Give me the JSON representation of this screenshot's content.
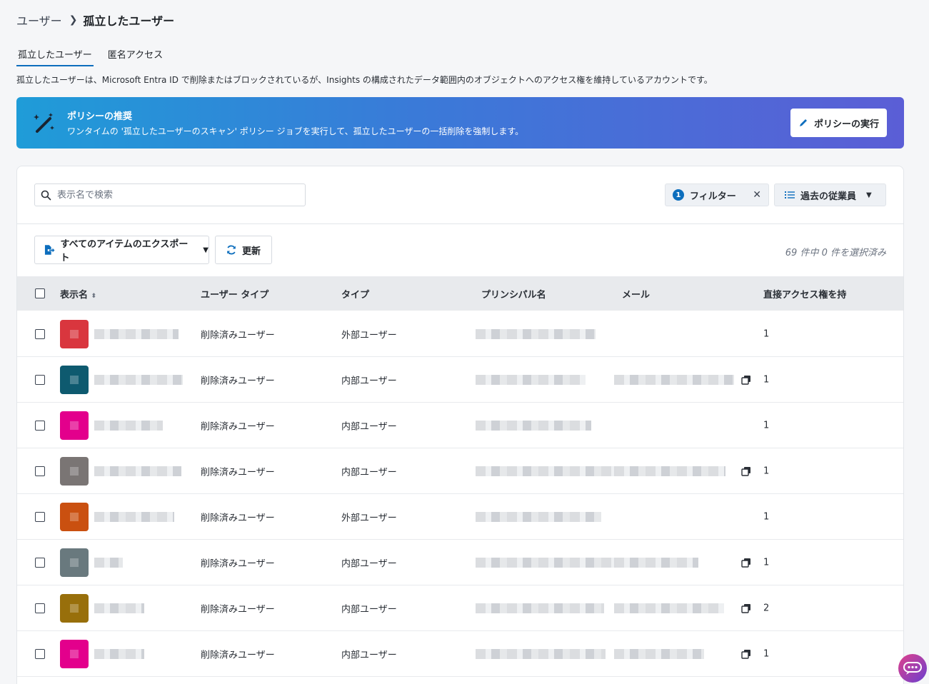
{
  "breadcrumb": {
    "root": "ユーザー",
    "current": "孤立したユーザー"
  },
  "tabs": [
    {
      "label": "孤立したユーザー",
      "active": true
    },
    {
      "label": "匿名アクセス",
      "active": false
    }
  ],
  "description": "孤立したユーザーは、Microsoft Entra ID で削除またはブロックされているが、Insights の構成されたデータ範囲内のオブジェクトへのアクセス権を維持しているアカウントです。",
  "banner": {
    "title": "ポリシーの推奨",
    "text": "ワンタイムの '孤立したユーザーのスキャン' ポリシー ジョブを実行して、孤立したユーザーの一括削除を強制します。",
    "button_label": "ポリシーの実行",
    "icon": "magic-wand-icon"
  },
  "toolbar": {
    "search_placeholder": "表示名で検索",
    "filter_count": "1",
    "filter_label": "フィルター",
    "view_label": "過去の従業員",
    "export_label": "すべてのアイテムのエクスポート",
    "refresh_label": "更新",
    "selection_status": "69 件中 0 件を選択済み"
  },
  "table": {
    "headers": {
      "name": "表示名",
      "user_type": "ユーザー タイプ",
      "type": "タイプ",
      "principal": "プリンシパル名",
      "mail": "メール",
      "direct_access": "直接アクセス権を持"
    },
    "rows": [
      {
        "avatar_color": "#d9363e",
        "user_type": "削除済みユーザー",
        "type": "外部ユーザー",
        "has_mail": false,
        "direct": "1"
      },
      {
        "avatar_color": "#0e5a6f",
        "user_type": "削除済みユーザー",
        "type": "内部ユーザー",
        "has_mail": true,
        "direct": "1"
      },
      {
        "avatar_color": "#e3008c",
        "user_type": "削除済みユーザー",
        "type": "内部ユーザー",
        "has_mail": false,
        "direct": "1"
      },
      {
        "avatar_color": "#7a7574",
        "user_type": "削除済みユーザー",
        "type": "内部ユーザー",
        "has_mail": true,
        "direct": "1"
      },
      {
        "avatar_color": "#ca5010",
        "user_type": "削除済みユーザー",
        "type": "外部ユーザー",
        "has_mail": false,
        "direct": "1"
      },
      {
        "avatar_color": "#69797e",
        "user_type": "削除済みユーザー",
        "type": "内部ユーザー",
        "has_mail": true,
        "direct": "1"
      },
      {
        "avatar_color": "#986f0b",
        "user_type": "削除済みユーザー",
        "type": "内部ユーザー",
        "has_mail": true,
        "direct": "2"
      },
      {
        "avatar_color": "#e3008c",
        "user_type": "削除済みユーザー",
        "type": "内部ユーザー",
        "has_mail": true,
        "direct": "1"
      }
    ]
  }
}
